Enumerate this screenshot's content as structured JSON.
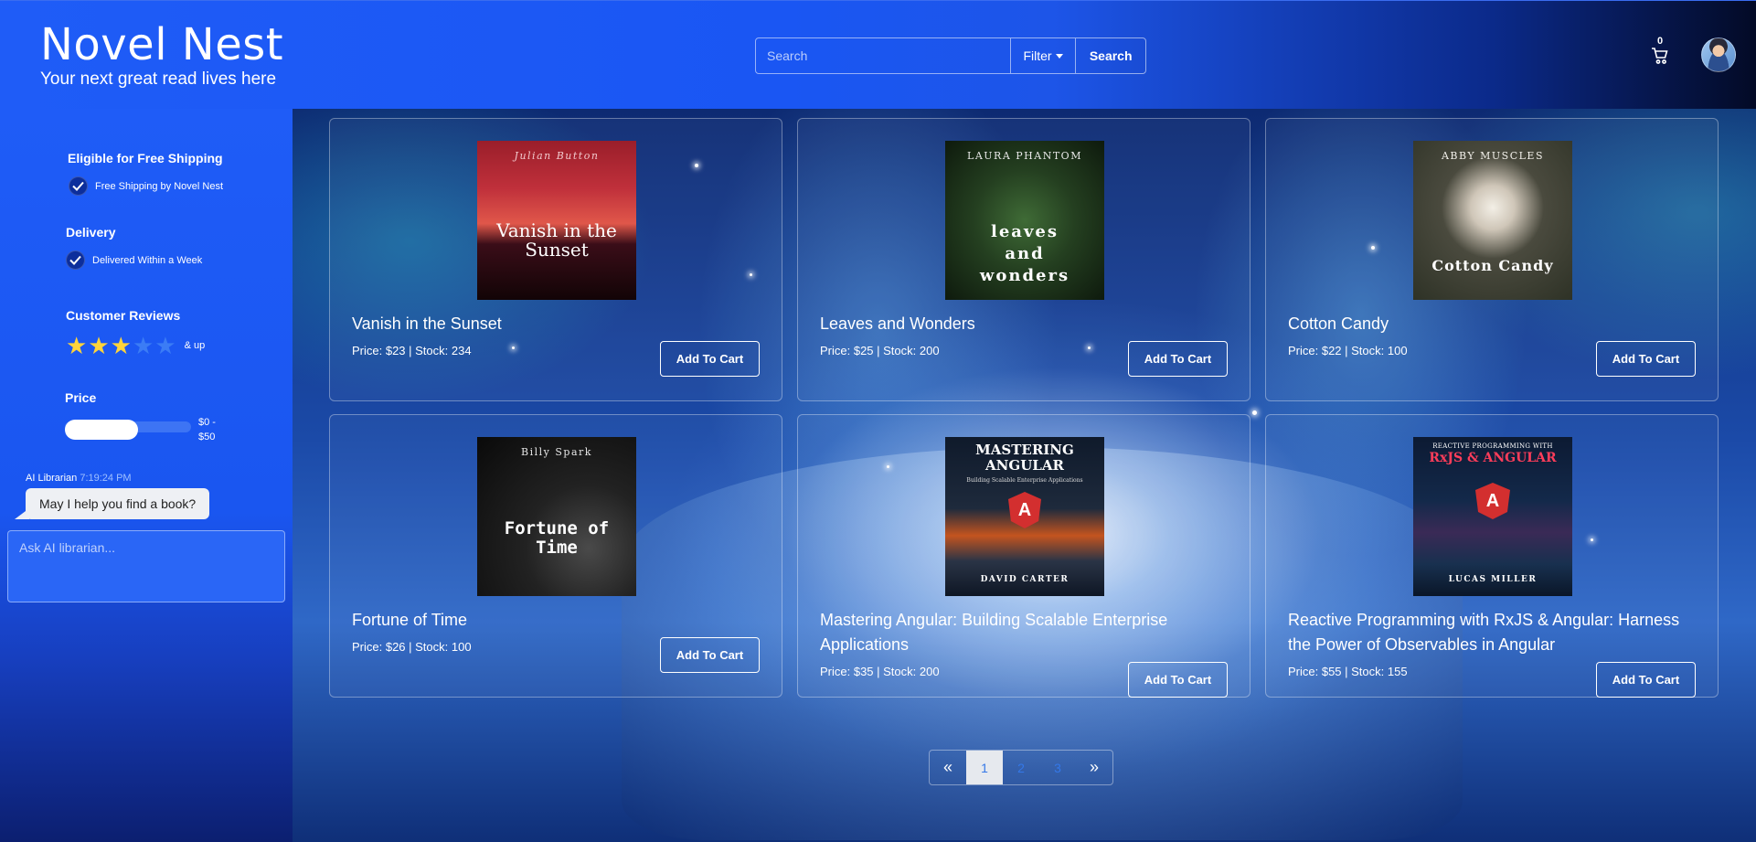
{
  "header": {
    "title": "Novel Nest",
    "tagline": "Your next great read lives here",
    "search_placeholder": "Search",
    "filter_label": "Filter",
    "search_button": "Search",
    "cart_count": "0"
  },
  "sidebar": {
    "shipping": {
      "title": "Eligible for Free Shipping",
      "option": "Free Shipping by Novel Nest",
      "checked": true
    },
    "delivery": {
      "title": "Delivery",
      "option": "Delivered Within a Week",
      "checked": true
    },
    "reviews": {
      "title": "Customer Reviews",
      "rating": 3,
      "max": 5,
      "label": "& up"
    },
    "price": {
      "title": "Price",
      "range_label_1": "$0 -",
      "range_label_2": "$50"
    }
  },
  "chat": {
    "sender": "AI Librarian",
    "time": "7:19:24 PM",
    "message": "May I help you find a book?",
    "input_placeholder": "Ask AI librarian..."
  },
  "books": [
    {
      "title": "Vanish in the Sunset",
      "meta": "Price: $23 | Stock: 234",
      "button": "Add To Cart",
      "cover_author": "Julian Button",
      "cover_title": "Vanish in the Sunset"
    },
    {
      "title": "Leaves and Wonders",
      "meta": "Price: $25 | Stock: 200",
      "button": "Add To Cart",
      "cover_author": "LAURA PHANTOM",
      "cover_title": "leaves and wonders"
    },
    {
      "title": "Cotton Candy",
      "meta": "Price: $22 | Stock: 100",
      "button": "Add To Cart",
      "cover_author": "ABBY MUSCLES",
      "cover_title": "Cotton Candy"
    },
    {
      "title": "Fortune of Time",
      "meta": "Price: $26 | Stock: 100",
      "button": "Add To Cart",
      "cover_author": "Billy Spark",
      "cover_title": "Fortune of Time"
    },
    {
      "title": "Mastering Angular: Building Scalable Enterprise Applications",
      "meta": "Price: $35 | Stock: 200",
      "button": "Add To Cart",
      "cover_author": "DAVID CARTER",
      "cover_title": "MASTERING ANGULAR",
      "cover_subtitle": "Building Scalable Enterprise Applications"
    },
    {
      "title": "Reactive Programming with RxJS & Angular: Harness the Power of Observables in Angular",
      "meta": "Price: $55 | Stock: 155",
      "button": "Add To Cart",
      "cover_author": "LUCAS MILLER",
      "cover_title": "RxJS & ANGULAR",
      "cover_pretitle": "REACTIVE PROGRAMMING WITH"
    }
  ],
  "pagination": {
    "prev": "«",
    "pages": [
      "1",
      "2",
      "3"
    ],
    "next": "»",
    "active": "1"
  },
  "colors": {
    "header_blue": "#1f5cf7",
    "star": "#ffd43b",
    "link": "#3478e8"
  },
  "icons": {
    "cart": "cart-icon",
    "check": "check-icon",
    "star": "star-icon"
  }
}
